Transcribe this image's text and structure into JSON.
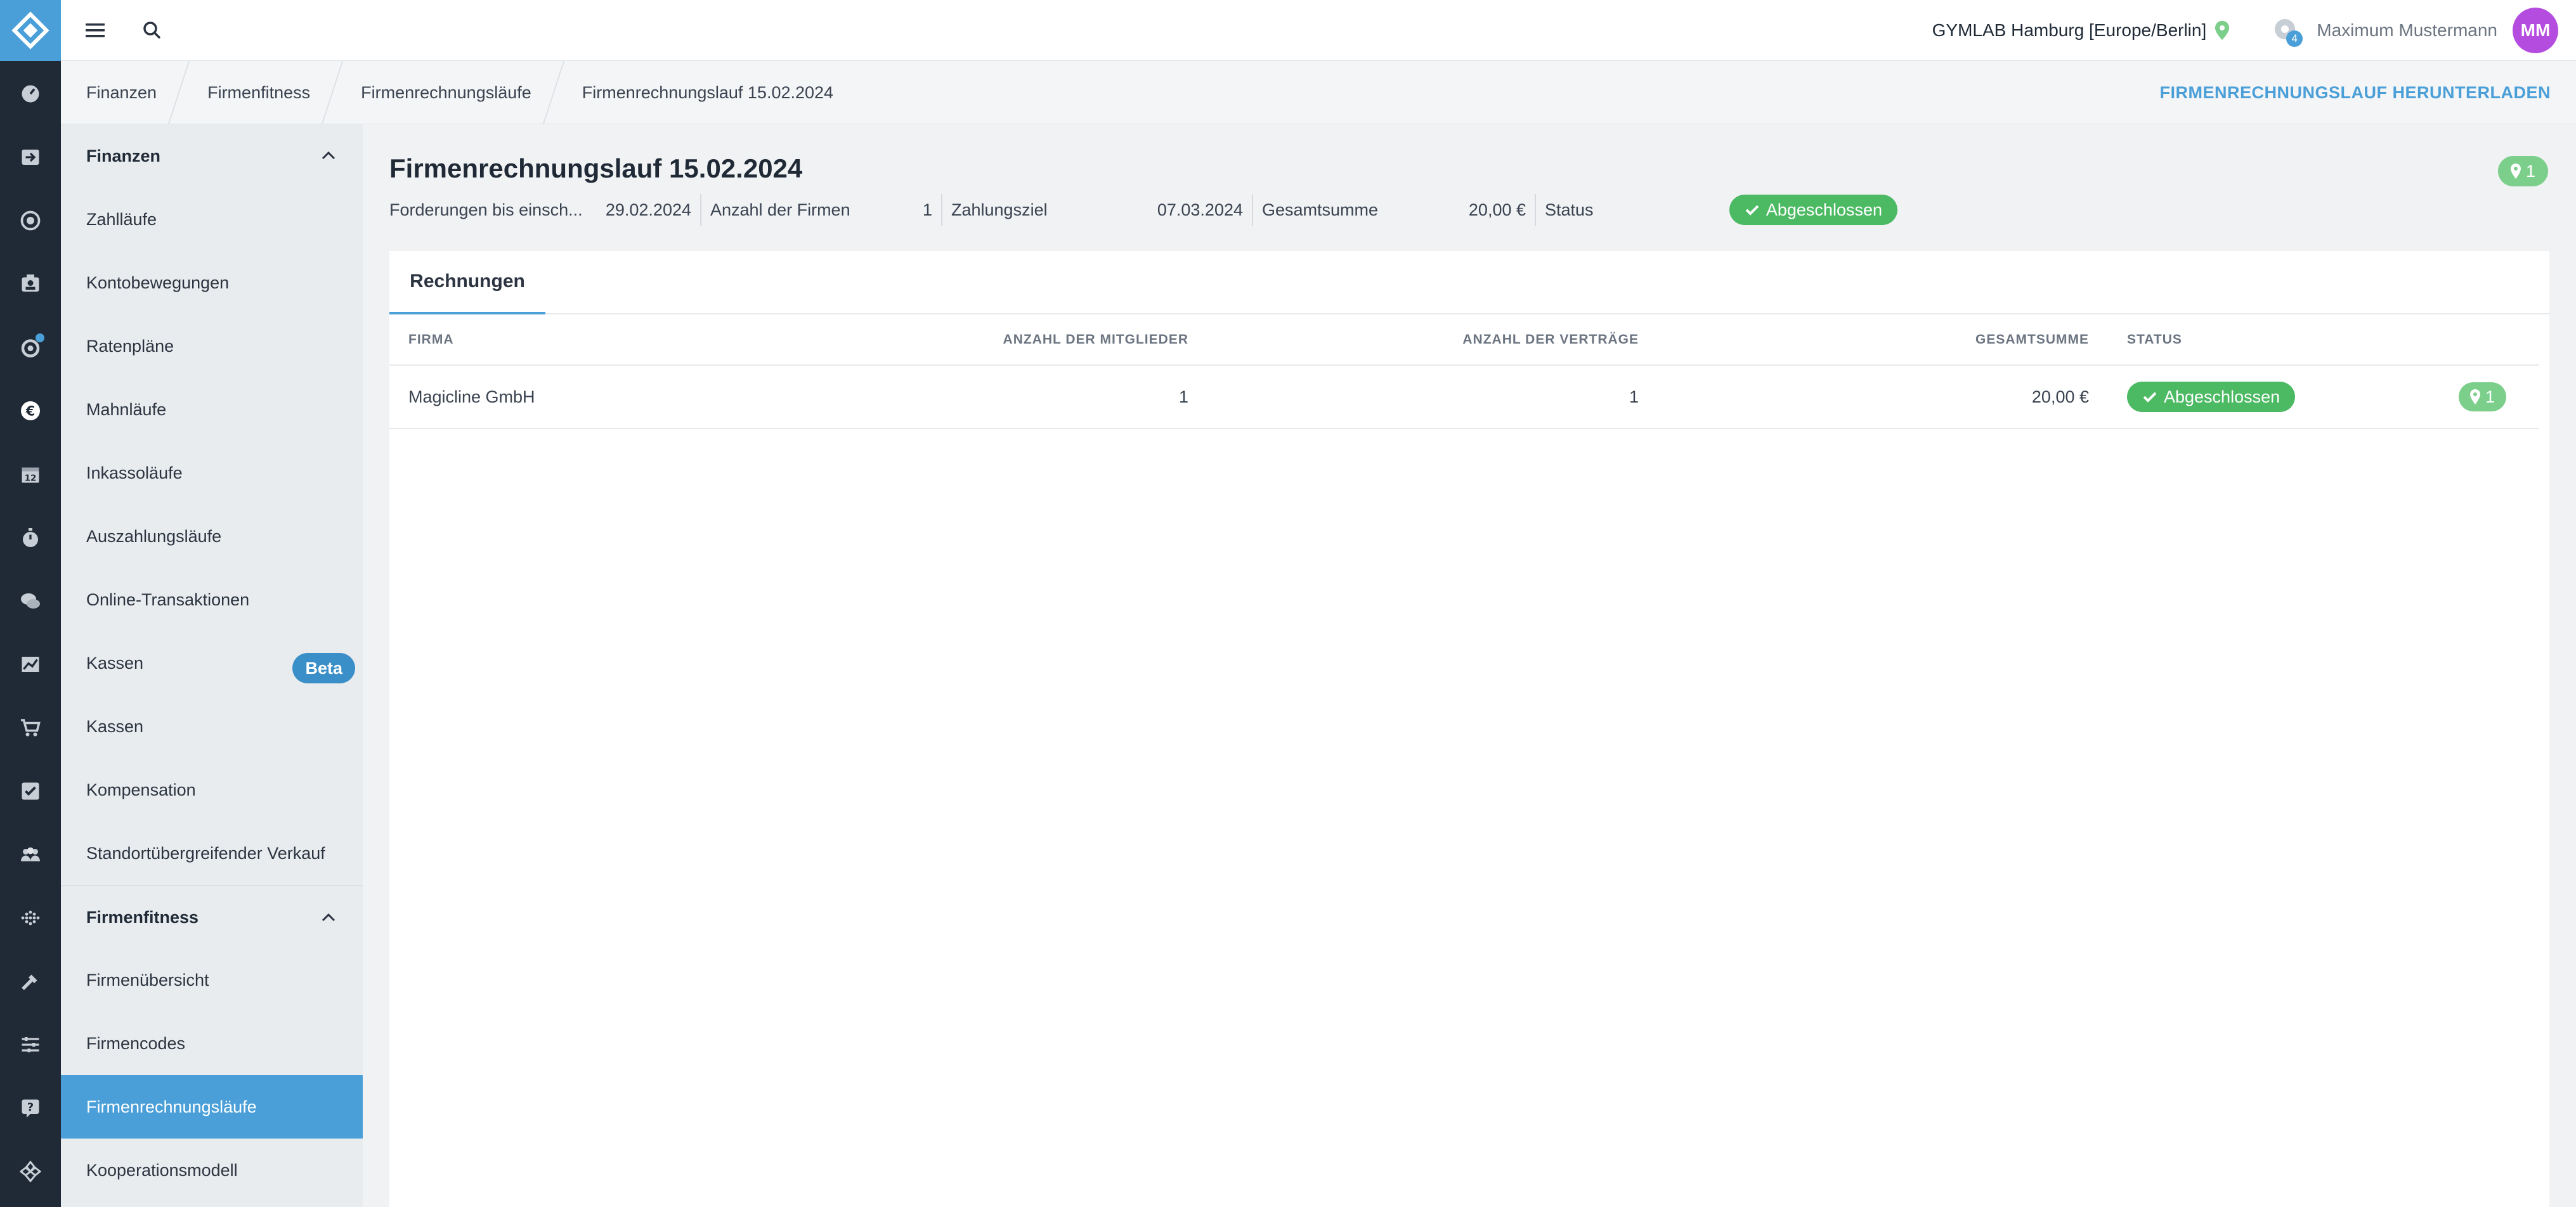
{
  "topbar": {
    "studio": "GYMLAB Hamburg [Europe/Berlin]",
    "notification_count": "4",
    "user_name": "Maximum Mustermann",
    "avatar_initials": "MM"
  },
  "breadcrumb": {
    "items": [
      "Finanzen",
      "Firmenfitness",
      "Firmenrechnungsläufe",
      "Firmenrechnungslauf 15.02.2024"
    ],
    "action_label": "FIRMENRECHNUNGSLAUF HERUNTERLADEN"
  },
  "sidebar": {
    "section1": {
      "title": "Finanzen",
      "items": [
        "Zahlläufe",
        "Kontobewegungen",
        "Ratenpläne",
        "Mahnläufe",
        "Inkassoläufe",
        "Auszahlungsläufe",
        "Online-Transaktionen",
        "Kassen",
        "Kassen",
        "Kompensation",
        "Standortübergreifender Verkauf"
      ],
      "beta_label": "Beta"
    },
    "section2": {
      "title": "Firmenfitness",
      "items": [
        "Firmenübersicht",
        "Firmencodes",
        "Firmenrechnungsläufe",
        "Kooperationsmodell"
      ],
      "active_index": 2
    }
  },
  "page": {
    "title": "Firmenrechnungslauf 15.02.2024",
    "location_count": "1",
    "info": {
      "claims_label": "Forderungen bis einsch...",
      "claims_value": "29.02.2024",
      "companies_label": "Anzahl der Firmen",
      "companies_value": "1",
      "due_label": "Zahlungsziel",
      "due_value": "07.03.2024",
      "total_label": "Gesamtsumme",
      "total_value": "20,00 €",
      "status_label": "Status",
      "status_value": "Abgeschlossen"
    }
  },
  "tabs": [
    "Rechnungen"
  ],
  "table": {
    "headers": [
      "Firma",
      "Anzahl der Mitglieder",
      "Anzahl der Verträge",
      "Gesamtsumme",
      "Status"
    ],
    "rows": [
      {
        "firma": "Magicline GmbH",
        "mitglieder": "1",
        "vertraege": "1",
        "summe": "20,00 €",
        "status": "Abgeschlossen",
        "locations": "1"
      }
    ]
  },
  "colors": {
    "accent": "#4a9fd8",
    "rail": "#1f2a36",
    "success": "#4cb963",
    "badge_green": "#7ccf8a",
    "avatar": "#b54ce0"
  },
  "rail_icons": [
    "dashboard-icon",
    "checkin-icon",
    "target-icon",
    "members-icon",
    "settings-alert-icon",
    "euro-icon",
    "calendar-icon",
    "stopwatch-icon",
    "chat-icon",
    "chart-icon",
    "cart-icon",
    "checkbox-icon",
    "group-icon",
    "pulse-icon",
    "tools-icon",
    "sliders-icon",
    "help-icon",
    "integrations-icon"
  ]
}
